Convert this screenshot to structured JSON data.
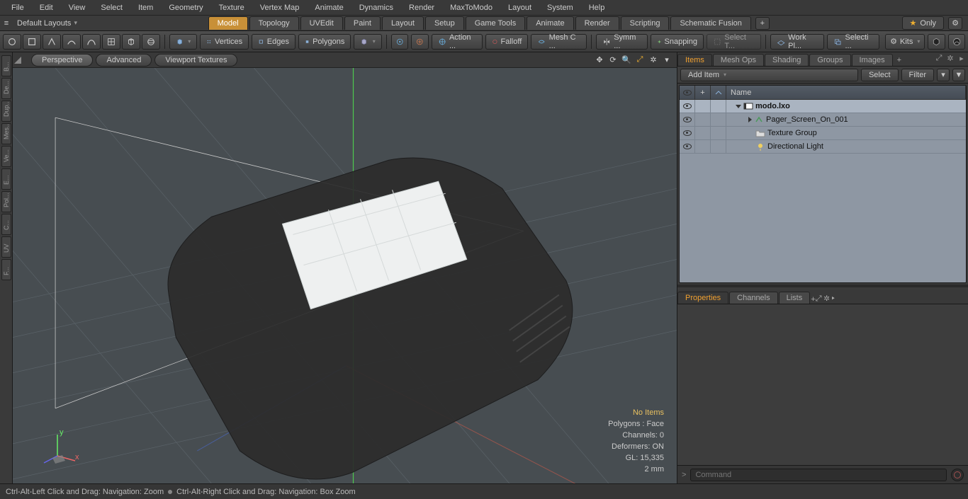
{
  "menubar": [
    "File",
    "Edit",
    "View",
    "Select",
    "Item",
    "Geometry",
    "Texture",
    "Vertex Map",
    "Animate",
    "Dynamics",
    "Render",
    "MaxToModo",
    "Layout",
    "System",
    "Help"
  ],
  "layouts_label": "Default Layouts",
  "mode_tabs": [
    "Model",
    "Topology",
    "UVEdit",
    "Paint",
    "Layout",
    "Setup",
    "Game Tools",
    "Animate",
    "Render",
    "Scripting",
    "Schematic Fusion"
  ],
  "mode_active": 0,
  "only_label": "Only",
  "toolbar": {
    "selmodes": [
      "Vertices",
      "Edges",
      "Polygons"
    ],
    "action": "Action ...",
    "falloff": "Falloff",
    "meshc": "Mesh C ...",
    "symm": "Symm ...",
    "snap": "Snapping",
    "selthru": "Select T...",
    "workpl": "Work Pl...",
    "selsets": "Selecti ...",
    "kits": "Kits"
  },
  "leftdock": [
    "B...",
    "De...",
    "Dup...",
    "Mes...",
    "Ve...",
    "E...",
    "Pol...",
    "C...",
    "UV",
    "F..."
  ],
  "viewport": {
    "tabs": [
      "Perspective",
      "Advanced",
      "Viewport Textures"
    ],
    "info": {
      "noitems": "No Items",
      "polys": "Polygons : Face",
      "channels": "Channels: 0",
      "deformers": "Deformers: ON",
      "gl": "GL: 15,335",
      "scale": "2 mm"
    }
  },
  "items_panel": {
    "tabs": [
      "Items",
      "Mesh Ops",
      "Shading",
      "Groups",
      "Images"
    ],
    "active": 0,
    "additem": "Add Item",
    "select": "Select",
    "filter": "Filter",
    "name_hdr": "Name",
    "tree": [
      {
        "name": "modo.lxo",
        "bold": true,
        "depth": 0,
        "expand": "down",
        "icon": "scene"
      },
      {
        "name": "Pager_Screen_On_001",
        "depth": 1,
        "expand": "right",
        "icon": "mesh"
      },
      {
        "name": "Texture Group",
        "depth": 1,
        "icon": "group"
      },
      {
        "name": "Directional Light",
        "depth": 1,
        "icon": "light"
      }
    ]
  },
  "props_tabs": [
    "Properties",
    "Channels",
    "Lists"
  ],
  "props_active": 0,
  "footer": {
    "hint1": "Ctrl-Alt-Left Click and Drag: Navigation: Zoom",
    "hint2": "Ctrl-Alt-Right Click and Drag: Navigation: Box Zoom"
  },
  "cmd_placeholder": "Command"
}
